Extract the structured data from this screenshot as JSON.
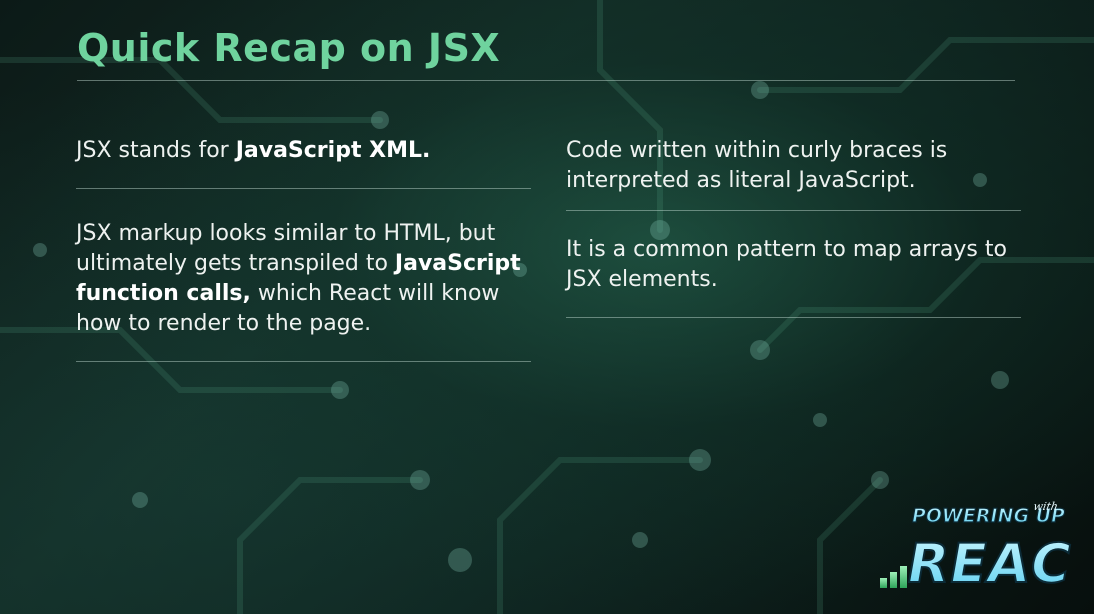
{
  "slide": {
    "title": "Quick Recap on JSX"
  },
  "left_column": {
    "point1": {
      "text": "JSX stands for ",
      "emphasis": "JavaScript XML."
    },
    "point2": {
      "text_before": "JSX markup looks similar to HTML, but ultimately gets transpiled to ",
      "emphasis": "JavaScript function calls,",
      "text_after": " which React will know how to render to the page."
    }
  },
  "right_column": {
    "point1": {
      "text": "Code written within curly braces is interpreted as literal JavaScript."
    },
    "point2": {
      "text": "It is a common pattern to map arrays to JSX elements."
    }
  },
  "logo": {
    "line1": "POWERING UP",
    "line2": "with",
    "line3": "REACT"
  },
  "colors": {
    "title": "#6fd39e",
    "logo_cyan": "#7fe7ff",
    "logo_green": "#3fbf6a"
  }
}
